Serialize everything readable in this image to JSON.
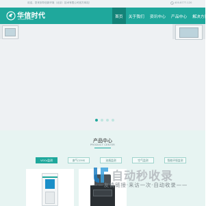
{
  "topbar": {
    "left_text": "欢迎，您来到华信新环境（北京）技术有限公司官方网站！",
    "phone": "400-8777-120"
  },
  "logo": {
    "text": "华信时代",
    "sub": "HUAXIN SHIDAI"
  },
  "nav": {
    "items": [
      "首页",
      "关于我们",
      "资讯中心",
      "产品中心",
      "解决方案"
    ],
    "active_index": 0
  },
  "banner": {
    "slide_count": 4,
    "active_slide": 1
  },
  "products": {
    "title": "产品中心",
    "subtitle": "PRODUCT CENTER",
    "tabs": [
      "VOCs监测",
      "废气CEMS",
      "油烟监测",
      "空气监测",
      "智能环境监测"
    ],
    "active_tab": 0
  },
  "watermark": {
    "brand": "自动秒收录",
    "tagline": "——友情链接·来访一次·自动收录——"
  },
  "colors": {
    "primary": "#1fa89c",
    "primary_dark": "#138378",
    "section_bg": "#e7f4f2"
  }
}
